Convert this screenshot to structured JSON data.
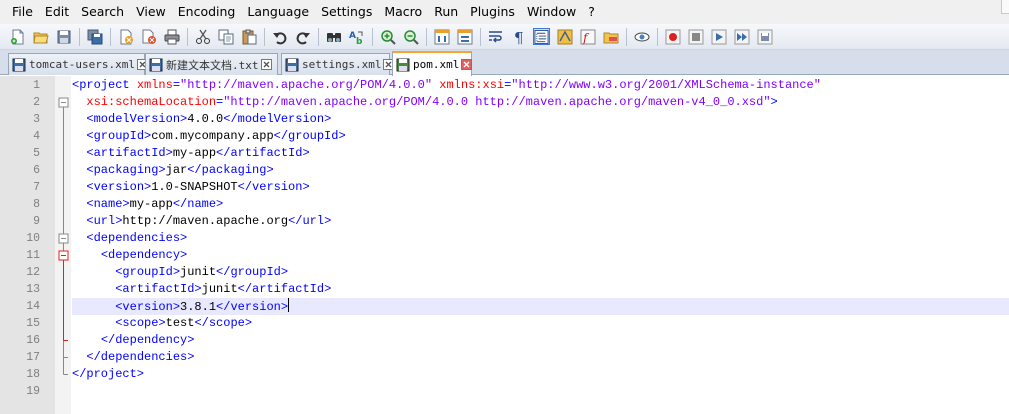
{
  "menu": [
    "File",
    "Edit",
    "Search",
    "View",
    "Encoding",
    "Language",
    "Settings",
    "Macro",
    "Run",
    "Plugins",
    "Window",
    "?"
  ],
  "toolbar": [
    "new-file-icon",
    "open-file-icon",
    "save-icon",
    "save-all-icon",
    "close-icon",
    "close-all-icon",
    "print-icon",
    "cut-icon",
    "copy-icon",
    "paste-icon",
    "undo-icon",
    "redo-icon",
    "find-icon",
    "replace-icon",
    "zoom-in-icon",
    "zoom-out-icon",
    "sync-vertical-icon",
    "sync-horizontal-icon",
    "word-wrap-icon",
    "show-all-chars-icon",
    "indent-guide-icon",
    "user-language-icon",
    "function-list-icon",
    "folder-as-workspace-icon",
    "document-map-icon",
    "record-macro-icon",
    "stop-recording-icon",
    "playback-icon",
    "run-multiple-icon",
    "save-macro-icon"
  ],
  "tabs": [
    {
      "label": "tomcat-users.xml",
      "active": false
    },
    {
      "label": "新建文本文档.txt",
      "active": false
    },
    {
      "label": "settings.xml",
      "active": false
    },
    {
      "label": "pom.xml",
      "active": true
    }
  ],
  "editor": {
    "current_line": 14,
    "line_numbers": [
      "1",
      "2",
      "3",
      "4",
      "5",
      "6",
      "7",
      "8",
      "9",
      "10",
      "11",
      "12",
      "13",
      "14",
      "15",
      "16",
      "17",
      "18",
      "19"
    ],
    "lines": [
      [
        [
          "tag",
          "<project "
        ],
        [
          "attr",
          "xmlns"
        ],
        [
          "tag",
          "="
        ],
        [
          "val",
          "\"http://maven.apache.org/POM/4.0.0\""
        ],
        [
          "tag",
          " "
        ],
        [
          "attr",
          "xmlns:xsi"
        ],
        [
          "tag",
          "="
        ],
        [
          "val",
          "\"http://www.w3.org/2001/XMLSchema-instance\""
        ]
      ],
      [
        [
          "txt",
          "  "
        ],
        [
          "attr",
          "xsi:schemaLocation"
        ],
        [
          "tag",
          "="
        ],
        [
          "val",
          "\"http://maven.apache.org/POM/4.0.0 http://maven.apache.org/maven-v4_0_0.xsd\""
        ],
        [
          "tag",
          ">"
        ]
      ],
      [
        [
          "txt",
          "  "
        ],
        [
          "tag",
          "<modelVersion>"
        ],
        [
          "txt",
          "4.0.0"
        ],
        [
          "tag",
          "</modelVersion>"
        ]
      ],
      [
        [
          "txt",
          "  "
        ],
        [
          "tag",
          "<groupId>"
        ],
        [
          "txt",
          "com.mycompany.app"
        ],
        [
          "tag",
          "</groupId>"
        ]
      ],
      [
        [
          "txt",
          "  "
        ],
        [
          "tag",
          "<artifactId>"
        ],
        [
          "txt",
          "my-app"
        ],
        [
          "tag",
          "</artifactId>"
        ]
      ],
      [
        [
          "txt",
          "  "
        ],
        [
          "tag",
          "<packaging>"
        ],
        [
          "txt",
          "jar"
        ],
        [
          "tag",
          "</packaging>"
        ]
      ],
      [
        [
          "txt",
          "  "
        ],
        [
          "tag",
          "<version>"
        ],
        [
          "txt",
          "1.0-SNAPSHOT"
        ],
        [
          "tag",
          "</version>"
        ]
      ],
      [
        [
          "txt",
          "  "
        ],
        [
          "tag",
          "<name>"
        ],
        [
          "txt",
          "my-app"
        ],
        [
          "tag",
          "</name>"
        ]
      ],
      [
        [
          "txt",
          "  "
        ],
        [
          "tag",
          "<url>"
        ],
        [
          "txt",
          "http://maven.apache.org"
        ],
        [
          "tag",
          "</url>"
        ]
      ],
      [
        [
          "txt",
          "  "
        ],
        [
          "tag",
          "<dependencies>"
        ]
      ],
      [
        [
          "txt",
          "    "
        ],
        [
          "tag",
          "<dependency>"
        ]
      ],
      [
        [
          "txt",
          "      "
        ],
        [
          "tag",
          "<groupId>"
        ],
        [
          "txt",
          "junit"
        ],
        [
          "tag",
          "</groupId>"
        ]
      ],
      [
        [
          "txt",
          "      "
        ],
        [
          "tag",
          "<artifactId>"
        ],
        [
          "txt",
          "junit"
        ],
        [
          "tag",
          "</artifactId>"
        ]
      ],
      [
        [
          "txt",
          "      "
        ],
        [
          "tag",
          "<version>"
        ],
        [
          "txt",
          "3.8.1"
        ],
        [
          "tag",
          "</version>"
        ]
      ],
      [
        [
          "txt",
          "      "
        ],
        [
          "tag",
          "<scope>"
        ],
        [
          "txt",
          "test"
        ],
        [
          "tag",
          "</scope>"
        ]
      ],
      [
        [
          "txt",
          "    "
        ],
        [
          "tag",
          "</dependency>"
        ]
      ],
      [
        [
          "txt",
          "  "
        ],
        [
          "tag",
          "</dependencies>"
        ]
      ],
      [
        [
          "tag",
          "</project>"
        ]
      ],
      []
    ]
  },
  "colors": {
    "tag": "#0000ff",
    "attr": "#ff0000",
    "value": "#8000ff",
    "text": "#000000",
    "current_line": "#e8e8ff",
    "active_tab_accent": "#f7a530"
  }
}
